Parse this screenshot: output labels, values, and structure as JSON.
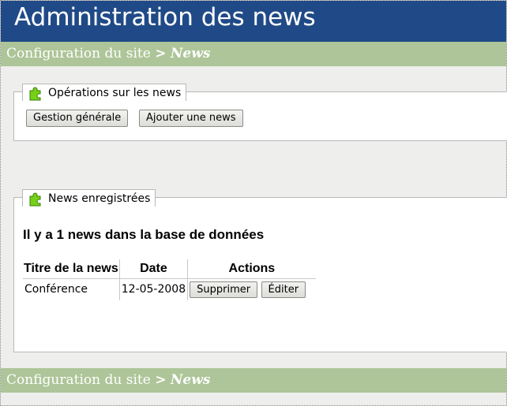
{
  "header": {
    "title": "Administration des news"
  },
  "breadcrumb": {
    "site_link": "Configuration du site",
    "separator": ">",
    "current": "News"
  },
  "operations_panel": {
    "legend": "Opérations sur les news",
    "icon": "puzzle-piece-icon",
    "buttons": {
      "manage_label": "Gestion générale",
      "add_label": "Ajouter une news"
    }
  },
  "news_panel": {
    "legend": "News enregistrées",
    "icon": "puzzle-piece-icon",
    "count_text": "Il y a 1 news dans la base de données",
    "table": {
      "headers": {
        "title": "Titre de la news",
        "date": "Date",
        "actions": "Actions"
      },
      "rows": [
        {
          "title": "Conférence",
          "date": "12-05-2008",
          "delete_label": "Supprimer",
          "edit_label": "Éditer"
        }
      ]
    }
  },
  "colors": {
    "header_bg": "#204a87",
    "breadcrumb_bg": "#adc598",
    "page_bg": "#eeeeec",
    "icon_green": "#73d216"
  }
}
